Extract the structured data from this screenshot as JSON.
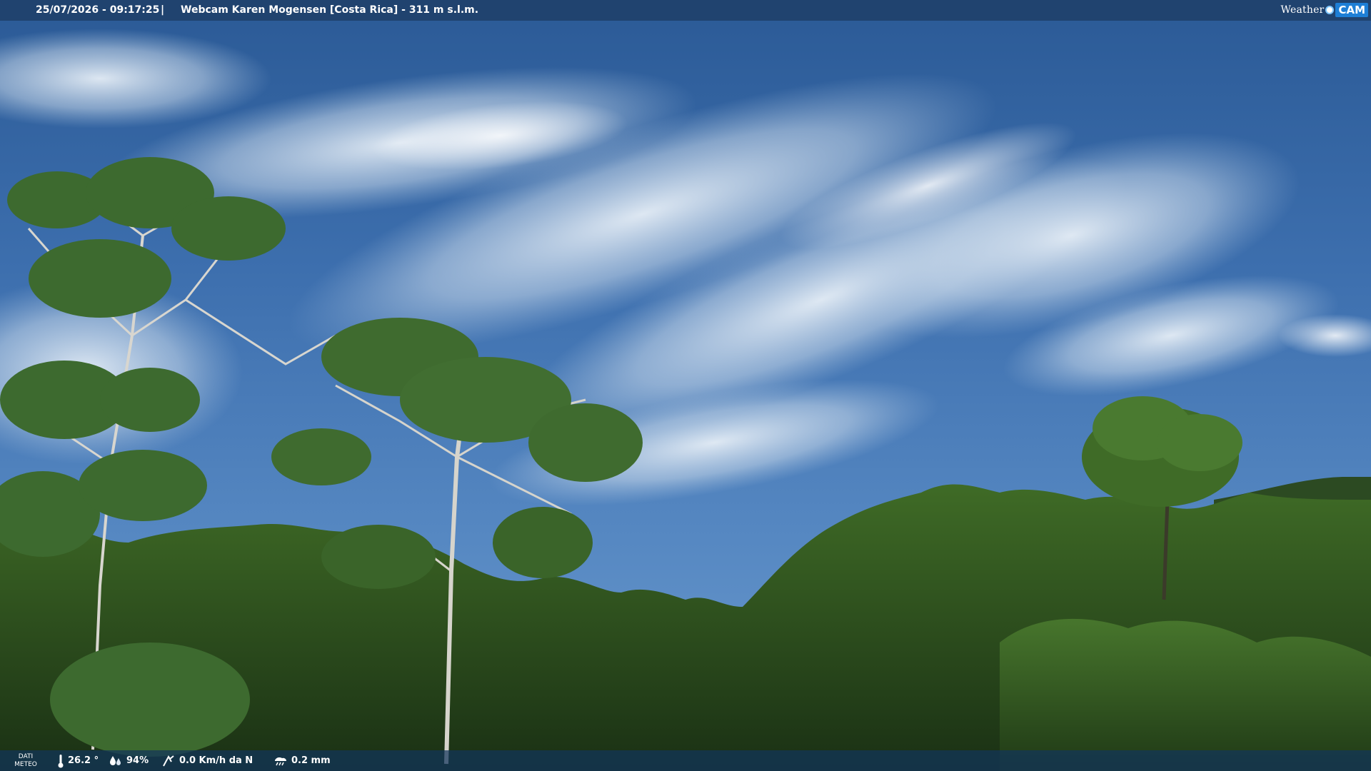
{
  "header": {
    "datetime": "25/07/2026 - 09:17:25",
    "separator": "|",
    "title": "Webcam Karen Mogensen [Costa Rica]  - 311 m s.l.m.",
    "brand_left": "Weather",
    "brand_right": "CAM"
  },
  "weather_bar": {
    "label_line1": "DATI",
    "label_line2": "METEO",
    "temperature": "26.2 °",
    "humidity": "94%",
    "wind": "0.0 Km/h da N",
    "rain": "0.2 mm"
  },
  "icons": {
    "temperature": "thermometer-icon",
    "humidity": "water-drops-icon",
    "wind": "wind-icon",
    "rain": "rain-gauge-icon",
    "brand_dot": "globe-dot-icon"
  },
  "colors": {
    "sky_top": "#2a5a98",
    "sky_mid": "#4c7fb8",
    "cloud": "#d9e4ef",
    "forest_dark": "#1b3515",
    "forest_light": "#3e6a24",
    "accent_blue": "#1e7fd6"
  }
}
